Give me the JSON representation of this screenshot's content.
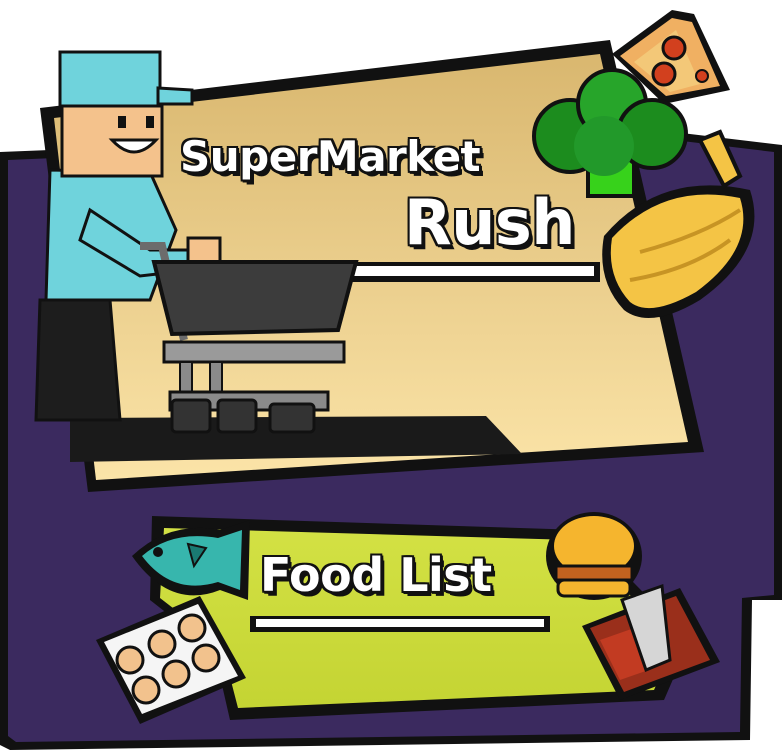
{
  "title": {
    "line1": "SuperMarket",
    "line2": "Rush"
  },
  "menu": {
    "food_list_label": "Food List"
  },
  "icons": [
    "shopper-with-cart-icon",
    "pizza-slice-icon",
    "broccoli-icon",
    "banana-bunch-icon",
    "fish-icon",
    "egg-carton-icon",
    "burger-icon",
    "meat-steak-icon"
  ],
  "colors": {
    "purple_panel": "#3b2a5f",
    "title_panel": "#eecb86",
    "food_list_panel": "#cddd3a",
    "shirt": "#6fd3dc",
    "outline": "#111111"
  }
}
